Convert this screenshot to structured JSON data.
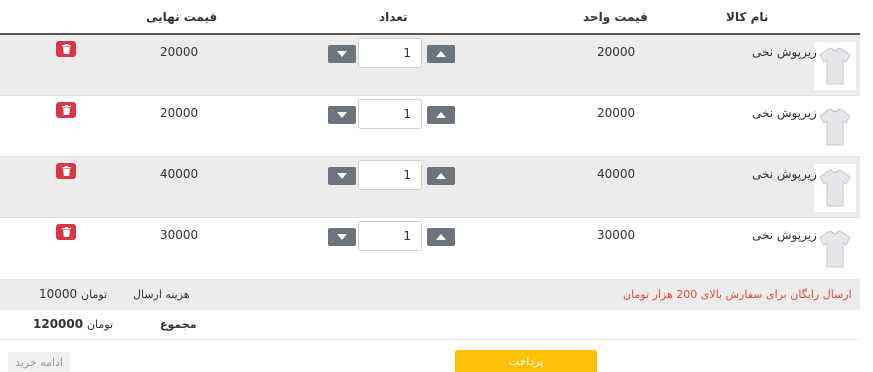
{
  "header": {
    "product_name": "نام کالا",
    "unit_price": "قیمت واحد",
    "quantity": "تعداد",
    "final_price": "قیمت نهایی"
  },
  "rows": [
    {
      "name": "زیرپوش نخی",
      "unit_price": "20000",
      "quantity": "1",
      "final_price": "20000",
      "thumbnail": "white-tshirt-image"
    },
    {
      "name": "زیرپوش نخی",
      "unit_price": "20000",
      "quantity": "1",
      "final_price": "20000",
      "thumbnail": "white-tshirt-image"
    },
    {
      "name": "زیرپوش نخی",
      "unit_price": "40000",
      "quantity": "1",
      "final_price": "40000",
      "thumbnail": "white-tshirt-image"
    },
    {
      "name": "زیرپوش نخی",
      "unit_price": "30000",
      "quantity": "1",
      "final_price": "30000",
      "thumbnail": "white-tshirt-image"
    }
  ],
  "icons": {
    "delete": "trash-icon",
    "decrease": "caret-down-icon",
    "increase": "caret-up-icon"
  },
  "shipping": {
    "notice": "ارسال رایگان برای سفارش بالای 200 هزار تومان",
    "label": "هزینه ارسال",
    "amount": "10000",
    "currency": "تومان"
  },
  "total": {
    "label": "مجموع",
    "amount": "120000",
    "currency": "تومان"
  },
  "actions": {
    "pay": "پرداخت",
    "continue_shopping": "ادامه خرید"
  },
  "colors": {
    "delete_button": "#dc3545",
    "pay_button": "#ffc107",
    "notice_text": "#e74c3c",
    "stepper_button": "#6c757d"
  }
}
